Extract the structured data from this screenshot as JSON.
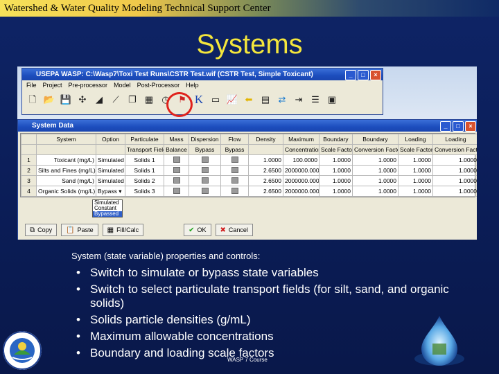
{
  "header": {
    "title": "Watershed & Water Quality Modeling Technical Support Center"
  },
  "slide": {
    "title": "Systems"
  },
  "app_window": {
    "title": "USEPA WASP: C:\\Wasp7\\Toxi Test Runs\\CSTR Test.wif (CSTR Test, Simple Toxicant)",
    "menu": [
      "File",
      "Project",
      "Pre-processor",
      "Model",
      "Post-Processor",
      "Help"
    ],
    "toolbar_icons": [
      "new-file-icon",
      "open-folder-icon",
      "save-icon",
      "network-icon",
      "chart-icon",
      "graph-icon",
      "window-icon",
      "grid-icon",
      "systems-icon",
      "flag-icon",
      "constants-icon",
      "kinetics-icon",
      "run-icon",
      "plot-icon",
      "arrow-icon",
      "layout-icon",
      "swap-icon",
      "export-icon",
      "text-icon",
      "monitor-icon"
    ]
  },
  "system_data": {
    "title": "System Data",
    "header_row1": [
      "",
      "System",
      "Particulate",
      "Mass",
      "Dispersion",
      "Flow",
      "Density",
      "Maximum",
      "Boundary",
      "Boundary",
      "Loading",
      "Loading"
    ],
    "header_row2": [
      "",
      "",
      "Transport Field",
      "Balance",
      "Bypass",
      "Bypass",
      "",
      "Concentration",
      "Scale Factor",
      "Conversion Factor",
      "Scale Factor",
      "Conversion Factor"
    ],
    "rows": [
      {
        "num": "1",
        "system": "Toxicant (mg/L)",
        "option": "Simulated",
        "particulate": "Solids 1",
        "density": "1.0000",
        "max": "100.0000",
        "b_scale": "1.0000",
        "b_conv": "1.0000",
        "l_scale": "1.0000",
        "l_conv": "1.0000"
      },
      {
        "num": "2",
        "system": "Silts and Fines (mg/L)",
        "option": "Simulated",
        "particulate": "Solids 1",
        "density": "2.6500",
        "max": "2000000.000",
        "b_scale": "1.0000",
        "b_conv": "1.0000",
        "l_scale": "1.0000",
        "l_conv": "1.0000"
      },
      {
        "num": "3",
        "system": "Sand (mg/L)",
        "option": "Simulated",
        "particulate": "Solids 2",
        "density": "2.6500",
        "max": "2000000.000",
        "b_scale": "1.0000",
        "b_conv": "1.0000",
        "l_scale": "1.0000",
        "l_conv": "1.0000"
      },
      {
        "num": "4",
        "system": "Organic Solids (mg/L)",
        "option": "Bypass",
        "particulate": "Solids 3",
        "density": "2.6500",
        "max": "2000000.000",
        "b_scale": "1.0000",
        "b_conv": "1.0000",
        "l_scale": "1.0000",
        "l_conv": "1.0000"
      }
    ],
    "dropdown_options": [
      "Simulated",
      "Constant",
      "Bypassed"
    ],
    "dropdown_selected": "Bypassed",
    "buttons": {
      "copy": "Copy",
      "paste": "Paste",
      "fill": "Fill/Calc",
      "ok": "OK",
      "cancel": "Cancel"
    }
  },
  "body": {
    "caption": "System (state variable) properties and controls:",
    "bullets": [
      "Switch to simulate or bypass state variables",
      "Switch to select particulate transport fields (for silt, sand, and organic solids)",
      "Solids particle densities (g/mL)",
      "Maximum allowable concentrations",
      "Boundary and loading scale factors"
    ],
    "footer": "WASP 7 Course"
  },
  "colors": {
    "background": "#0d1f5c",
    "title": "#f4e63c",
    "text": "#ffffff",
    "highlight_circle": "#e0221c"
  }
}
